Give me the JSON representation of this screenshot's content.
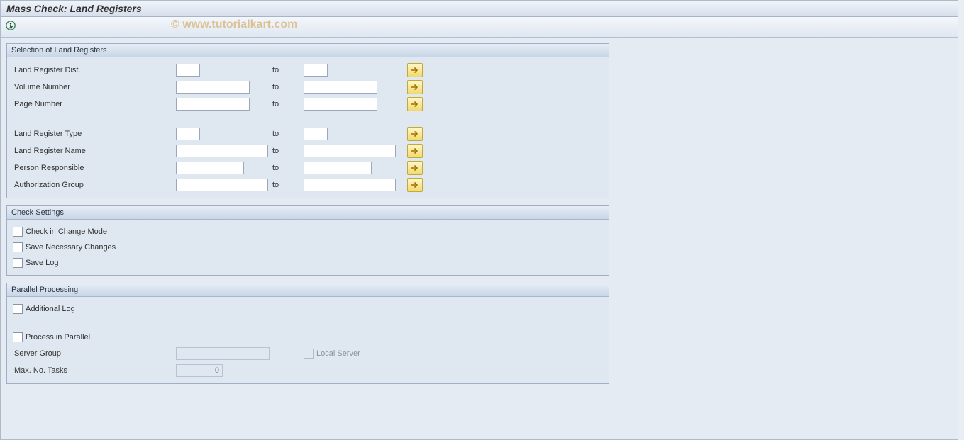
{
  "title": "Mass Check: Land Registers",
  "watermark": "© www.tutorialkart.com",
  "groups": {
    "sel": {
      "title": "Selection of Land Registers",
      "rows": {
        "dist": {
          "label": "Land Register Dist.",
          "to": "to"
        },
        "vol": {
          "label": "Volume Number",
          "to": "to"
        },
        "page": {
          "label": "Page Number",
          "to": "to"
        },
        "type": {
          "label": "Land Register Type",
          "to": "to"
        },
        "name": {
          "label": "Land Register Name",
          "to": "to"
        },
        "resp": {
          "label": "Person Responsible",
          "to": "to"
        },
        "auth": {
          "label": "Authorization Group",
          "to": "to"
        }
      }
    },
    "chk": {
      "title": "Check Settings",
      "items": {
        "change": "Check in Change Mode",
        "save": "Save Necessary Changes",
        "log": "Save Log"
      }
    },
    "pp": {
      "title": "Parallel Processing",
      "addlog": "Additional Log",
      "parallel": "Process in Parallel",
      "server_label": "Server Group",
      "local": "Local Server",
      "max_label": "Max. No. Tasks",
      "max_value": "0"
    }
  }
}
